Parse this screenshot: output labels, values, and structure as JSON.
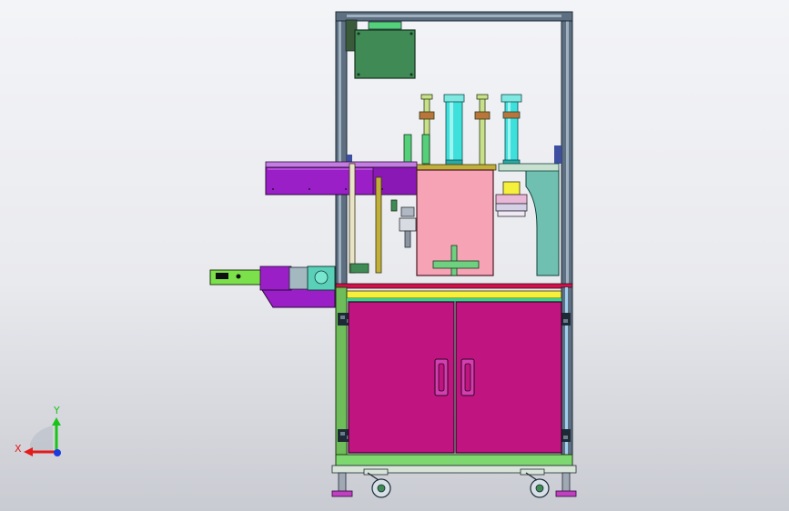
{
  "viewport": {
    "background_top": "#f3f4f7",
    "background_bottom": "#c9cbd2"
  },
  "model": {
    "parts": [
      "aluminium-frame",
      "top-control-panel",
      "cylinder-assembly",
      "pink-press-block",
      "teal-bracket",
      "purple-conveyor",
      "green-feeder",
      "magenta-cabinet",
      "leveling-feet",
      "casters"
    ],
    "colors": {
      "frame": "#5d6f80",
      "frame_highlight": "#9fb0c0",
      "panel": "#3f8a55",
      "cylinder": "#c8e08a",
      "cylinder_glass": "#3ee0dc",
      "press_block": "#f6a3b5",
      "bracket": "#6fc0b0",
      "conveyor": "#9b1fc6",
      "feeder": "#7be04a",
      "cabinet": "#c01580",
      "cabinet_trim": "#d43eb0",
      "rail": "#c0b03a",
      "yellow_bar": "#f4f03c",
      "red_bar": "#d0124a",
      "base": "#7ed870",
      "feet": "#c040c0"
    }
  },
  "triad": {
    "x_label": "X",
    "y_label": "Y",
    "x_color": "#e31b1b",
    "y_color": "#19c419",
    "z_color": "#1a3be0"
  }
}
